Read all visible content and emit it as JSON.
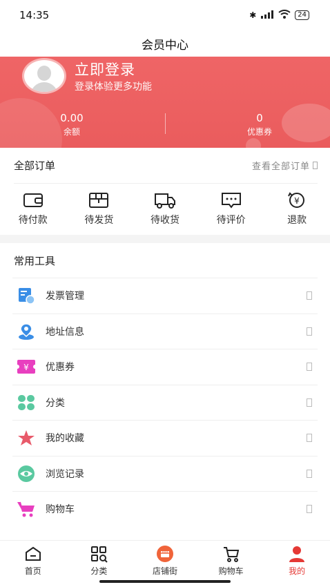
{
  "status_bar": {
    "time": "14:35",
    "battery": "24"
  },
  "nav": {
    "title": "会员中心"
  },
  "header": {
    "login_title": "立即登录",
    "login_subtitle": "登录体验更多功能",
    "balance_value": "0.00",
    "balance_label": "余额",
    "coupon_value": "0",
    "coupon_label": "优惠券",
    "color": "#ea5c5d"
  },
  "orders": {
    "title": "全部订单",
    "view_all": "查看全部订单",
    "items": [
      {
        "label": "待付款",
        "icon": "wallet-icon"
      },
      {
        "label": "待发货",
        "icon": "package-icon"
      },
      {
        "label": "待收货",
        "icon": "truck-icon"
      },
      {
        "label": "待评价",
        "icon": "comment-icon"
      },
      {
        "label": "退款",
        "icon": "refund-icon"
      }
    ]
  },
  "tools": {
    "title": "常用工具",
    "items": [
      {
        "label": "发票管理",
        "icon": "invoice-icon",
        "color": "#3a8ee6"
      },
      {
        "label": "地址信息",
        "icon": "location-icon",
        "color": "#3a8ee6"
      },
      {
        "label": "优惠券",
        "icon": "coupon-icon",
        "color": "#e83fbf"
      },
      {
        "label": "分类",
        "icon": "category-icon",
        "color": "#5ac9a0"
      },
      {
        "label": "我的收藏",
        "icon": "star-icon",
        "color": "#e85a6a"
      },
      {
        "label": "浏览记录",
        "icon": "eye-icon",
        "color": "#5ac9a0"
      },
      {
        "label": "购物车",
        "icon": "cart-icon",
        "color": "#e83fbf"
      }
    ]
  },
  "tab_bar": {
    "items": [
      {
        "label": "首页",
        "icon": "home-icon"
      },
      {
        "label": "分类",
        "icon": "category-grid-icon"
      },
      {
        "label": "店铺街",
        "icon": "store-icon"
      },
      {
        "label": "购物车",
        "icon": "cart-icon"
      },
      {
        "label": "我的",
        "icon": "user-icon",
        "active": true
      }
    ],
    "active_color": "#e53935"
  }
}
